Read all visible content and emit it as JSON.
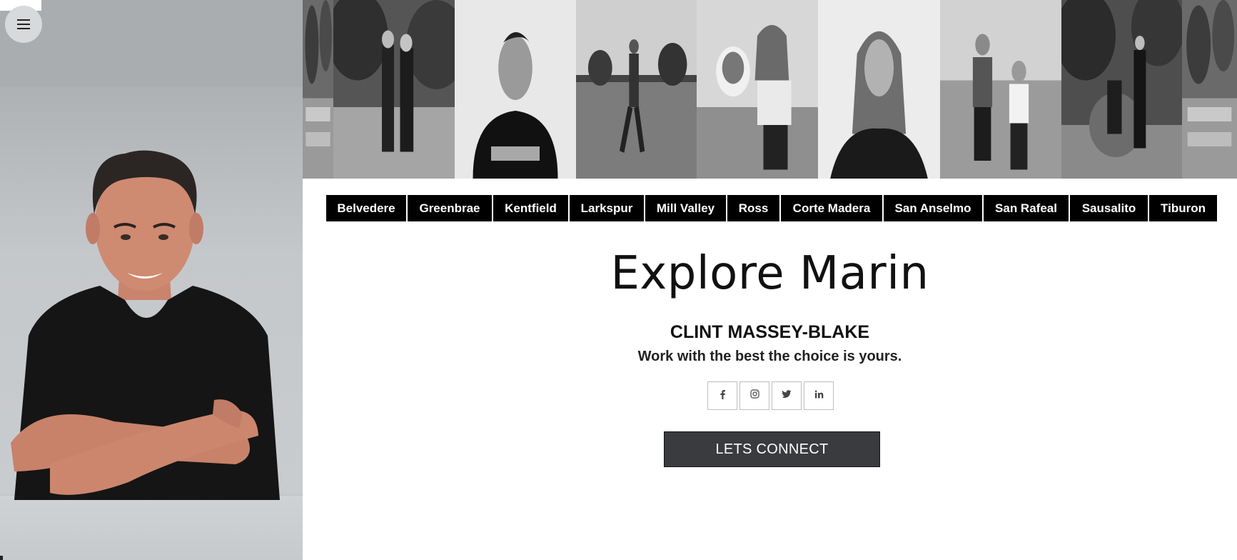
{
  "menu": {
    "icon": "hamburger-menu-icon"
  },
  "towns": [
    "Belvedere",
    "Greenbrae",
    "Kentfield",
    "Larkspur",
    "Mill Valley",
    "Ross",
    "Corte Madera",
    "San Anselmo",
    "San Rafeal",
    "Sausalito",
    "Tiburon"
  ],
  "main": {
    "title": "Explore Marin",
    "agent_name": "CLINT MASSEY-BLAKE",
    "tagline": "Work with the best the choice is yours.",
    "cta_label": "LETS CONNECT"
  },
  "social": [
    {
      "name": "facebook",
      "icon": "facebook-icon",
      "glyph": "f"
    },
    {
      "name": "instagram",
      "icon": "instagram-icon",
      "glyph": ""
    },
    {
      "name": "twitter",
      "icon": "twitter-icon",
      "glyph": ""
    },
    {
      "name": "linkedin",
      "icon": "linkedin-icon",
      "glyph": "in"
    }
  ],
  "photo_strip": [
    {
      "subject": "garden-steps"
    },
    {
      "subject": "couple-standing-garden"
    },
    {
      "subject": "man-black-tshirt-portrait"
    },
    {
      "subject": "golfer-swing"
    },
    {
      "subject": "woman-with-dog-on-sofa"
    },
    {
      "subject": "woman-portrait"
    },
    {
      "subject": "couple-seated"
    },
    {
      "subject": "couple-garden-chair"
    },
    {
      "subject": "garden-steps"
    }
  ],
  "colors": {
    "nav_background": "#000000",
    "nav_text": "#ffffff",
    "cta_background": "#3a3b3e",
    "page_background": "#ffffff"
  }
}
